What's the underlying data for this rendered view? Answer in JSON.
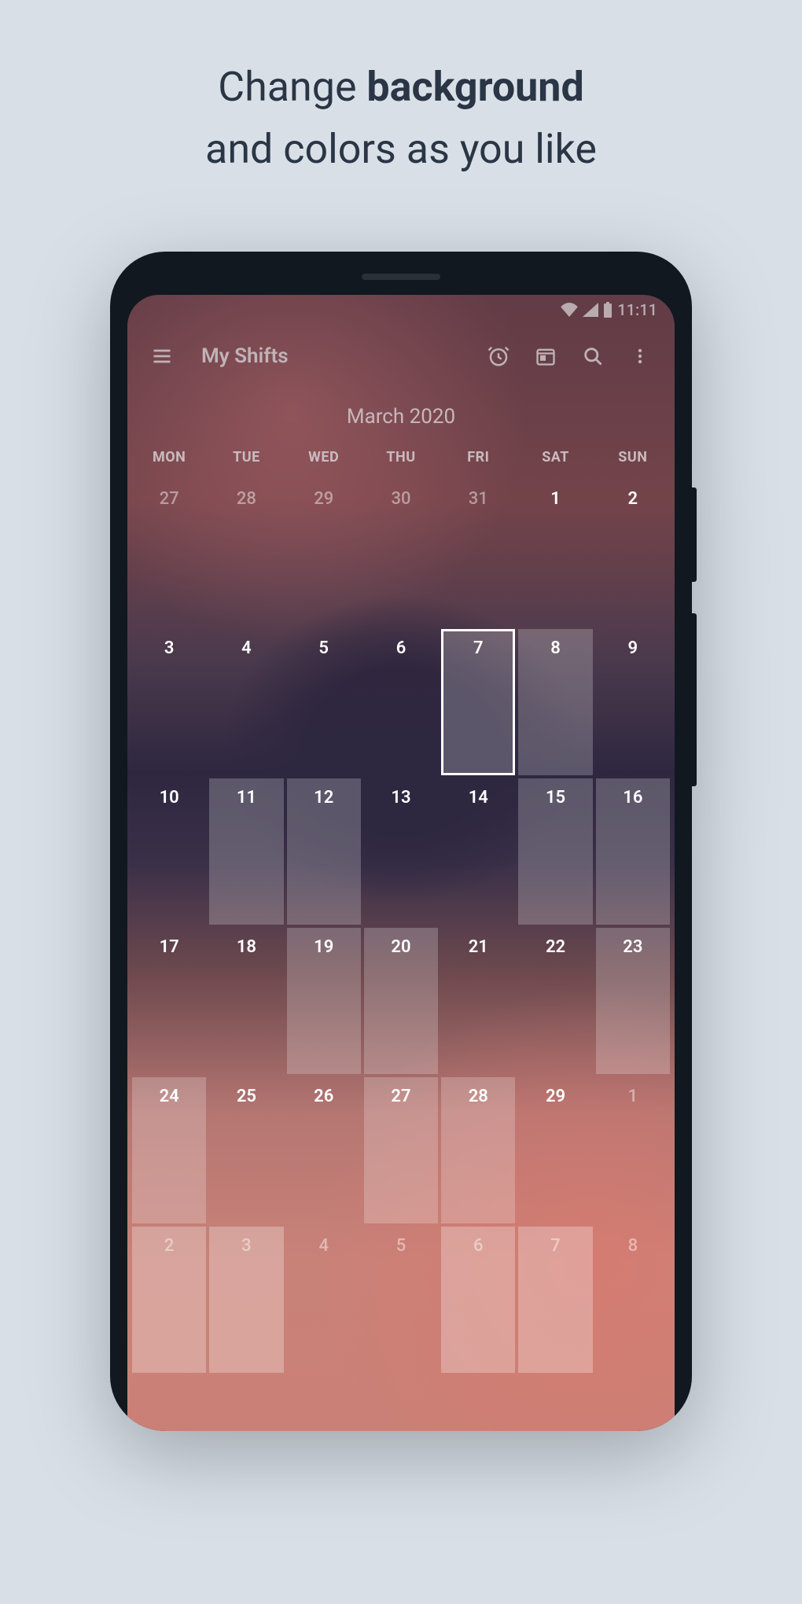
{
  "promo": {
    "line1_pre": "Change ",
    "line1_bold": "background",
    "line2": "and colors as you like"
  },
  "status": {
    "time": "11:11"
  },
  "appbar": {
    "title": "My Shifts"
  },
  "calendar": {
    "month_label": "March 2020",
    "dow": [
      "MON",
      "TUE",
      "WED",
      "THU",
      "FRI",
      "SAT",
      "SUN"
    ],
    "weeks": [
      [
        {
          "n": "27",
          "other": true,
          "shift": false,
          "sel": false
        },
        {
          "n": "28",
          "other": true,
          "shift": false,
          "sel": false
        },
        {
          "n": "29",
          "other": true,
          "shift": false,
          "sel": false
        },
        {
          "n": "30",
          "other": true,
          "shift": false,
          "sel": false
        },
        {
          "n": "31",
          "other": true,
          "shift": false,
          "sel": false
        },
        {
          "n": "1",
          "other": false,
          "shift": false,
          "sel": false
        },
        {
          "n": "2",
          "other": false,
          "shift": false,
          "sel": false
        }
      ],
      [
        {
          "n": "3",
          "other": false,
          "shift": false,
          "sel": false
        },
        {
          "n": "4",
          "other": false,
          "shift": false,
          "sel": false
        },
        {
          "n": "5",
          "other": false,
          "shift": false,
          "sel": false
        },
        {
          "n": "6",
          "other": false,
          "shift": false,
          "sel": false
        },
        {
          "n": "7",
          "other": false,
          "shift": true,
          "sel": true
        },
        {
          "n": "8",
          "other": false,
          "shift": true,
          "sel": false
        },
        {
          "n": "9",
          "other": false,
          "shift": false,
          "sel": false
        }
      ],
      [
        {
          "n": "10",
          "other": false,
          "shift": false,
          "sel": false
        },
        {
          "n": "11",
          "other": false,
          "shift": true,
          "sel": false
        },
        {
          "n": "12",
          "other": false,
          "shift": true,
          "sel": false
        },
        {
          "n": "13",
          "other": false,
          "shift": false,
          "sel": false
        },
        {
          "n": "14",
          "other": false,
          "shift": false,
          "sel": false
        },
        {
          "n": "15",
          "other": false,
          "shift": true,
          "sel": false
        },
        {
          "n": "16",
          "other": false,
          "shift": true,
          "sel": false
        }
      ],
      [
        {
          "n": "17",
          "other": false,
          "shift": false,
          "sel": false
        },
        {
          "n": "18",
          "other": false,
          "shift": false,
          "sel": false
        },
        {
          "n": "19",
          "other": false,
          "shift": true,
          "sel": false
        },
        {
          "n": "20",
          "other": false,
          "shift": true,
          "sel": false
        },
        {
          "n": "21",
          "other": false,
          "shift": false,
          "sel": false
        },
        {
          "n": "22",
          "other": false,
          "shift": false,
          "sel": false
        },
        {
          "n": "23",
          "other": false,
          "shift": true,
          "sel": false
        }
      ],
      [
        {
          "n": "24",
          "other": false,
          "shift": true,
          "sel": false
        },
        {
          "n": "25",
          "other": false,
          "shift": false,
          "sel": false
        },
        {
          "n": "26",
          "other": false,
          "shift": false,
          "sel": false
        },
        {
          "n": "27",
          "other": false,
          "shift": true,
          "sel": false
        },
        {
          "n": "28",
          "other": false,
          "shift": true,
          "sel": false
        },
        {
          "n": "29",
          "other": false,
          "shift": false,
          "sel": false
        },
        {
          "n": "1",
          "other": true,
          "shift": false,
          "sel": false
        }
      ],
      [
        {
          "n": "2",
          "other": true,
          "shift": true,
          "sel": false
        },
        {
          "n": "3",
          "other": true,
          "shift": true,
          "sel": false
        },
        {
          "n": "4",
          "other": true,
          "shift": false,
          "sel": false
        },
        {
          "n": "5",
          "other": true,
          "shift": false,
          "sel": false
        },
        {
          "n": "6",
          "other": true,
          "shift": true,
          "sel": false
        },
        {
          "n": "7",
          "other": true,
          "shift": true,
          "sel": false
        },
        {
          "n": "8",
          "other": true,
          "shift": false,
          "sel": false
        }
      ]
    ]
  }
}
